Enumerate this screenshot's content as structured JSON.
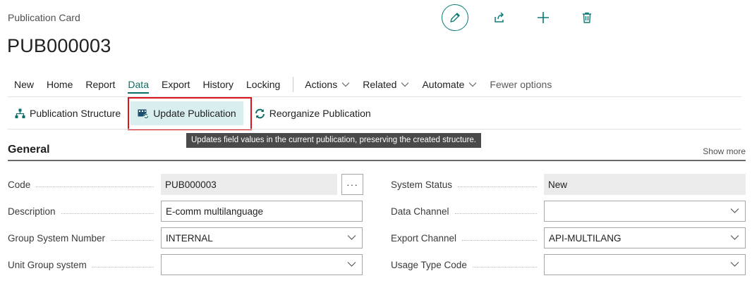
{
  "header": {
    "caption": "Publication Card",
    "title": "PUB000003"
  },
  "top_actions": [
    {
      "name": "edit",
      "icon": "pencil-icon"
    },
    {
      "name": "share",
      "icon": "share-icon"
    },
    {
      "name": "new",
      "icon": "plus-icon"
    },
    {
      "name": "delete",
      "icon": "trash-icon"
    }
  ],
  "menu": {
    "items": [
      "New",
      "Home",
      "Report",
      "Data",
      "Export",
      "History",
      "Locking"
    ],
    "active": "Data",
    "dropdowns": [
      "Actions",
      "Related",
      "Automate"
    ],
    "fewer_options": "Fewer options"
  },
  "sub_actions": {
    "publication_structure": "Publication Structure",
    "update_publication": "Update Publication",
    "reorganize_publication": "Reorganize Publication"
  },
  "tooltip": "Updates field values in the current publication, preserving the created structure.",
  "section": {
    "title": "General",
    "show_more": "Show more"
  },
  "fields_left": {
    "code": {
      "label": "Code",
      "value": "PUB000003"
    },
    "description": {
      "label": "Description",
      "value": "E-comm multilanguage"
    },
    "group_system_number": {
      "label": "Group System Number",
      "value": "INTERNAL"
    },
    "unit_group_system": {
      "label": "Unit Group system",
      "value": ""
    }
  },
  "fields_right": {
    "system_status": {
      "label": "System Status",
      "value": "New"
    },
    "data_channel": {
      "label": "Data Channel",
      "value": ""
    },
    "export_channel": {
      "label": "Export Channel",
      "value": "API-MULTILANG"
    },
    "usage_type_code": {
      "label": "Usage Type Code",
      "value": ""
    }
  },
  "ellipsis": "···",
  "colors": {
    "accent": "#0b6e69",
    "highlight": "#d9141b",
    "selected_bg": "#d9eeee",
    "tooltip_bg": "#4a4a4a"
  }
}
